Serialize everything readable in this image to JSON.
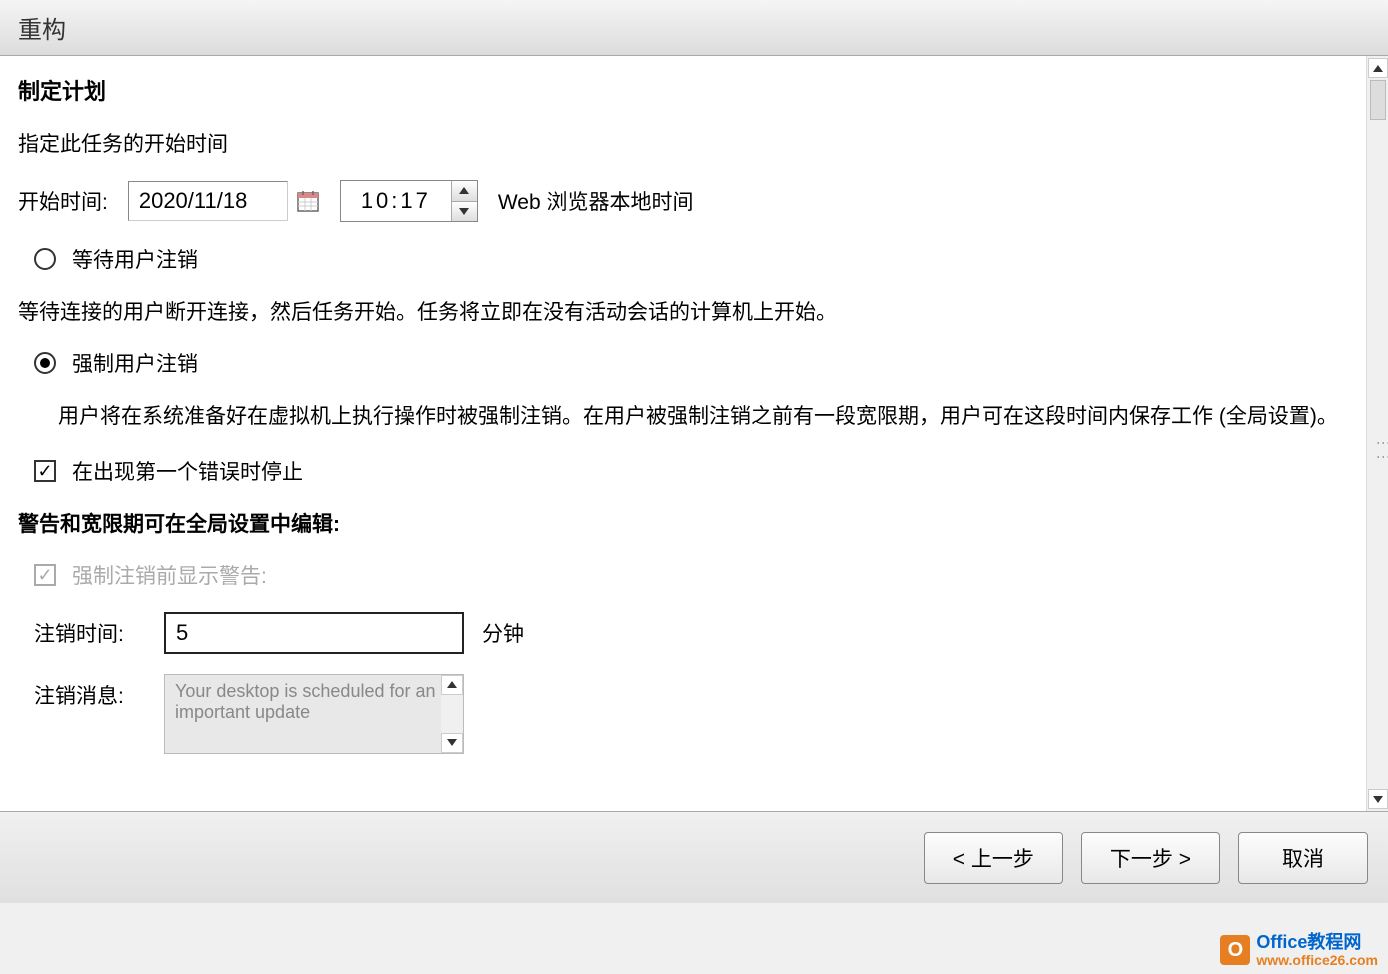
{
  "dialog": {
    "title": "重构"
  },
  "section": {
    "heading": "制定计划",
    "subtitle": "指定此任务的开始时间",
    "start_label": "开始时间:",
    "date_value": "2020/11/18",
    "time_value": "10:17",
    "tz_label": "Web 浏览器本地时间"
  },
  "radios": {
    "wait_logout": "等待用户注销",
    "wait_desc": "等待连接的用户断开连接，然后任务开始。任务将立即在没有活动会话的计算机上开始。",
    "force_logout": "强制用户注销",
    "force_desc": "用户将在系统准备好在虚拟机上执行操作时被强制注销。在用户被强制注销之前有一段宽限期，用户可在这段时间内保存工作 (全局设置)。"
  },
  "checks": {
    "stop_on_error": "在出现第一个错误时停止",
    "warning_section": "警告和宽限期可在全局设置中编辑:",
    "show_warning": "强制注销前显示警告:"
  },
  "fields": {
    "logout_time_label": "注销时间:",
    "logout_time_value": "5",
    "logout_time_unit": "分钟",
    "logout_msg_label": "注销消息:",
    "logout_msg_value": "Your desktop is scheduled for an important update"
  },
  "footer": {
    "prev": "< 上一步",
    "next": "下一步 >",
    "cancel": "取消"
  },
  "watermark": {
    "line1": "Office教程网",
    "line2": "www.office26.com"
  }
}
